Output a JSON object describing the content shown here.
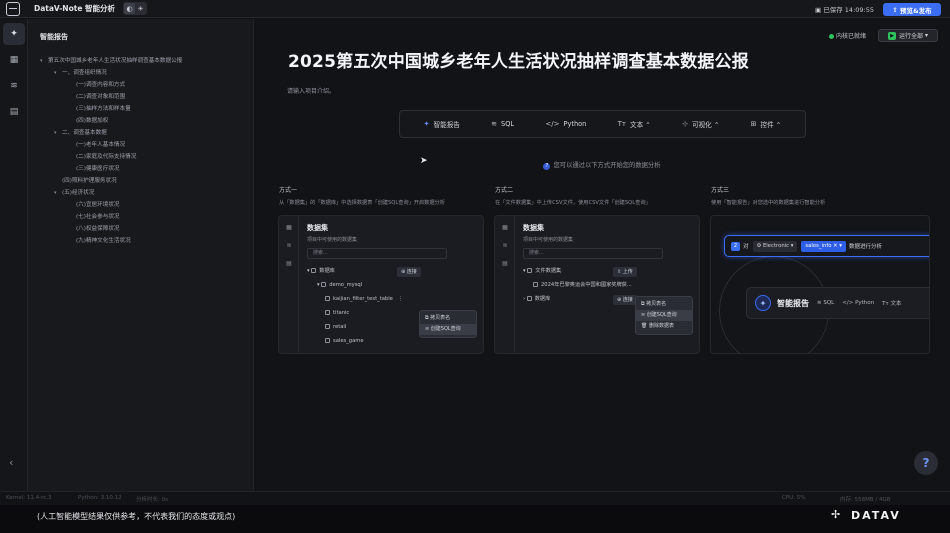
{
  "topbar": {
    "app_title": "DataV-Note 智能分析",
    "save_status": "已保存 14:09:55",
    "publish_label": "预览&发布"
  },
  "outline": {
    "title": "智能报告",
    "items": [
      {
        "label": "第五次中国城乡老年人生活状况抽样调查基本数据公报",
        "level": 0,
        "caret": "▾"
      },
      {
        "label": "一、调查组织情况",
        "level": 1,
        "caret": "▾"
      },
      {
        "label": "(一)调查内容和方式",
        "level": 2,
        "caret": ""
      },
      {
        "label": "(二)调查对象和范围",
        "level": 2,
        "caret": ""
      },
      {
        "label": "(三)抽样方法和样本量",
        "level": 2,
        "caret": ""
      },
      {
        "label": "(四)数据加权",
        "level": 2,
        "caret": ""
      },
      {
        "label": "二、调查基本数据",
        "level": 1,
        "caret": "▾"
      },
      {
        "label": "(一)老年人基本情况",
        "level": 2,
        "caret": ""
      },
      {
        "label": "(二)家庭及代际支持情况",
        "level": 2,
        "caret": ""
      },
      {
        "label": "(三)健康医疗状况",
        "level": 2,
        "caret": ""
      },
      {
        "label": "(四)照料护理服务状况",
        "level": 1,
        "caret": ""
      },
      {
        "label": "(五)经济状况",
        "level": 1,
        "caret": "▾"
      },
      {
        "label": "(六)宜居环境状况",
        "level": 2,
        "caret": ""
      },
      {
        "label": "(七)社会参与状况",
        "level": 2,
        "caret": ""
      },
      {
        "label": "(八)权益保障状况",
        "level": 2,
        "caret": ""
      },
      {
        "label": "(九)精神文化生活状况",
        "level": 2,
        "caret": ""
      }
    ]
  },
  "main": {
    "kernel_status": "内核已就绪",
    "run_label": "运行全部",
    "title": "2025第五次中国城乡老年人生活状况抽样调查基本数据公报",
    "intro_placeholder": "请输入项目介绍。",
    "toolbar": [
      {
        "icon": "ai-report-icon",
        "glyph": "✦",
        "label": "智能报告"
      },
      {
        "icon": "database-icon",
        "glyph": "≋",
        "label": "SQL"
      },
      {
        "icon": "code-icon",
        "glyph": "</>",
        "label": "Python"
      },
      {
        "icon": "text-icon",
        "glyph": "Tт",
        "label": "文本 ⌃"
      },
      {
        "icon": "chart-icon",
        "glyph": "⊹",
        "label": "可视化 ⌃"
      },
      {
        "icon": "widget-icon",
        "glyph": "⊞",
        "label": "控件 ⌃"
      }
    ],
    "hint": "您可以通过以下方式开始您的数据分析",
    "methods": [
      {
        "label": "方式一",
        "desc": "从「数据集」的「数据库」中选择数据表「创建SQL查询」开启数据分析"
      },
      {
        "label": "方式二",
        "desc": "在「文件数据集」中上传CSV文件，使用CSV文件「创建SQL查询」"
      },
      {
        "label": "方式三",
        "desc": "使用「智能报告」对您选中的数据集进行智能分析"
      }
    ]
  },
  "card1": {
    "title": "数据集",
    "subtitle": "项目中可使用的数据集",
    "search_placeholder": "搜索...",
    "tree": [
      {
        "label": "数据库",
        "indent": 0
      },
      {
        "label": "demo_mysql",
        "indent": 1
      },
      {
        "label": "kaijian_filter_test_table",
        "indent": 2
      },
      {
        "label": "titanic",
        "indent": 2
      },
      {
        "label": "retail",
        "indent": 2
      },
      {
        "label": "sales_game",
        "indent": 2
      }
    ],
    "connect_label": "连接",
    "menu": [
      "拷贝表名",
      "创建SQL查询"
    ]
  },
  "card2": {
    "title": "数据集",
    "subtitle": "项目中可使用的数据集",
    "search_placeholder": "搜索...",
    "tree": [
      {
        "label": "文件数据集",
        "indent": 0
      },
      {
        "label": "2024年巴黎奥运会中国和國家奖牌获...",
        "indent": 1
      },
      {
        "label": "数据库",
        "indent": 0
      }
    ],
    "upload_label": "上传",
    "connect_label": "连接",
    "menu": [
      "拷贝表名",
      "创建SQL查询",
      "删除数据表"
    ]
  },
  "card3": {
    "step": "2",
    "pair_label": "对",
    "chip_source": "Electronic",
    "chip_table": "sales_info",
    "action": "数据进行分析",
    "ai_label": "智能报告",
    "opts": [
      "SQL",
      "</> Python",
      "Tт 文本"
    ]
  },
  "statusbar": {
    "kernel": "Kernel: 11.4-rc.3",
    "python": "Python: 3.10.12",
    "time": "分析时长: 0s",
    "cpu": "CPU: 5%",
    "mem": "内存: 558MB / 4GB"
  },
  "caption": {
    "disclaimer": "(人工智能模型结果仅供参考，不代表我们的态度或观点)",
    "brand": "DATAV"
  }
}
